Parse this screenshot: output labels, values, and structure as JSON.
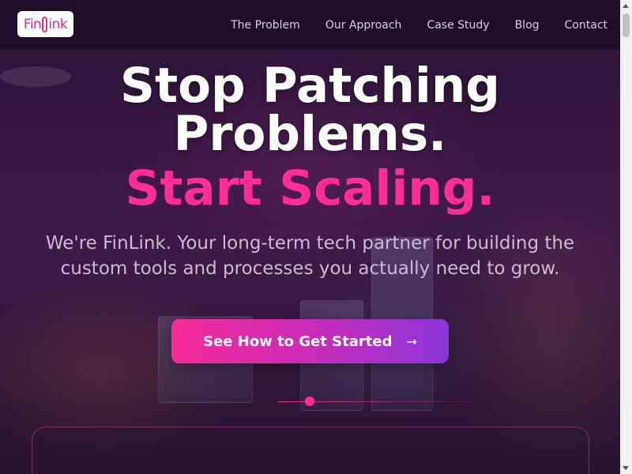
{
  "brand": {
    "logo_text_left": "Fin",
    "logo_text_right": "ink",
    "accent_color": "#ff2d95"
  },
  "nav": {
    "items": [
      {
        "label": "The Problem"
      },
      {
        "label": "Our Approach"
      },
      {
        "label": "Case Study"
      },
      {
        "label": "Blog"
      },
      {
        "label": "Contact"
      }
    ]
  },
  "hero": {
    "headline_line1": "Stop Patching",
    "headline_line2": "Problems.",
    "headline_accent": "Start Scaling.",
    "subtext": "We're FinLink. Your long-term tech partner for building the custom tools and processes you actually need to grow.",
    "cta_label": "See How to Get Started",
    "cta_icon": "arrow-right-icon"
  }
}
